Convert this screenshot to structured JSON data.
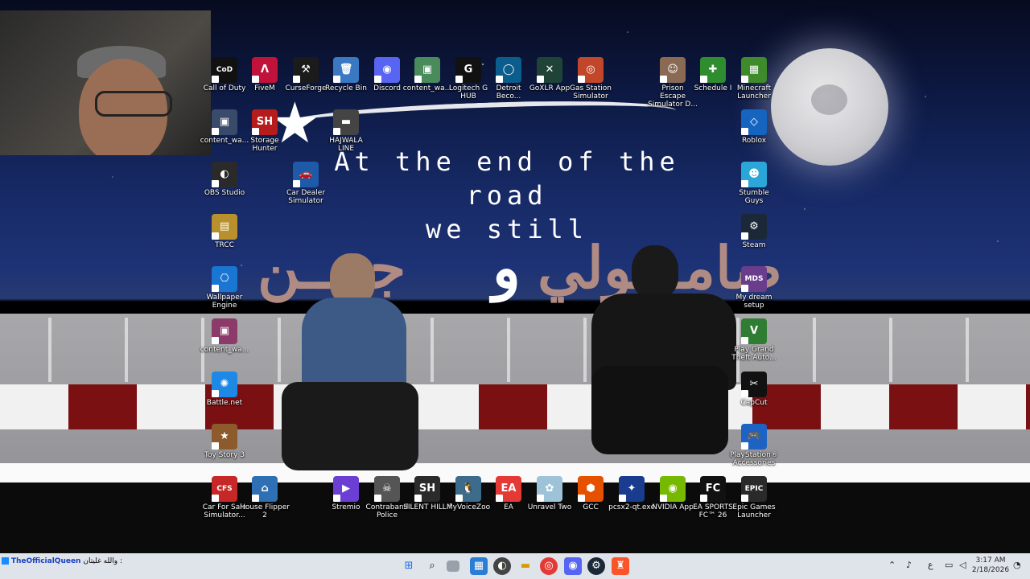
{
  "wallpaper": {
    "quote_line1": "At the end of the road",
    "quote_line2": "we still",
    "arabic_left": "جبـــن",
    "arabic_mid": "و",
    "arabic_right": "صامـــولي"
  },
  "desktop_icons": [
    {
      "label": "Call of Duty",
      "icon": "cod-icon",
      "color": "#111111",
      "glyph": "CoD"
    },
    {
      "label": "FiveM",
      "icon": "fivem-icon",
      "color": "#c0123a",
      "glyph": "Λ"
    },
    {
      "label": "CurseForge",
      "icon": "curseforge-icon",
      "color": "#1b1b1b",
      "glyph": "⚒"
    },
    {
      "label": "Recycle Bin",
      "icon": "recycle-bin-icon",
      "color": "#3a78c2",
      "glyph": "🗑"
    },
    {
      "label": "Discord",
      "icon": "discord-icon",
      "color": "#5865f2",
      "glyph": "◉"
    },
    {
      "label": "content_wa...",
      "icon": "image-file-icon",
      "color": "#4a8b5c",
      "glyph": "▣"
    },
    {
      "label": "Logitech G HUB",
      "icon": "logitech-icon",
      "color": "#111111",
      "glyph": "G"
    },
    {
      "label": "Detroit Beco...",
      "icon": "detroit-icon",
      "color": "#0a5d8c",
      "glyph": "◯"
    },
    {
      "label": "GoXLR App",
      "icon": "goxlr-icon",
      "color": "#1f4437",
      "glyph": "✕"
    },
    {
      "label": "Gas Station Simulator",
      "icon": "gas-station-icon",
      "color": "#c2462a",
      "glyph": "◎"
    },
    {
      "label": "Prison Escape Simulator D...",
      "icon": "prison-escape-icon",
      "color": "#8b6a55",
      "glyph": "☺"
    },
    {
      "label": "Schedule I",
      "icon": "schedule-i-icon",
      "color": "#2f8d2f",
      "glyph": "✚"
    },
    {
      "label": "Minecraft Launcher",
      "icon": "minecraft-icon",
      "color": "#3f8a2a",
      "glyph": "▦"
    },
    {
      "label": "content_wa...",
      "icon": "image-file-icon",
      "color": "#3a4a6a",
      "glyph": "▣"
    },
    {
      "label": "Storage Hunter",
      "icon": "storage-hunter-icon",
      "color": "#b71c1c",
      "glyph": "SH"
    },
    {
      "label": "HAJWALA LINE",
      "icon": "hajwala-icon",
      "color": "#444444",
      "glyph": "▬"
    },
    {
      "label": "Roblox",
      "icon": "roblox-icon",
      "color": "#1565c0",
      "glyph": "◇"
    },
    {
      "label": "OBS Studio",
      "icon": "obs-icon",
      "color": "#2a2a2a",
      "glyph": "◐"
    },
    {
      "label": "Car Dealer Simulator",
      "icon": "car-dealer-icon",
      "color": "#1e5aa8",
      "glyph": "🚗"
    },
    {
      "label": "Stumble Guys",
      "icon": "stumble-guys-icon",
      "color": "#2aa7d8",
      "glyph": "☻"
    },
    {
      "label": "TRCC",
      "icon": "trcc-icon",
      "color": "#b8902c",
      "glyph": "▤"
    },
    {
      "label": "Steam",
      "icon": "steam-icon",
      "color": "#1b2838",
      "glyph": "⚙"
    },
    {
      "label": "Wallpaper Engine",
      "icon": "wallpaper-engine-icon",
      "color": "#1976d2",
      "glyph": "⎔"
    },
    {
      "label": "My dream setup",
      "icon": "my-dream-setup-icon",
      "color": "#6a3c8c",
      "glyph": "MDS"
    },
    {
      "label": "content_wa...",
      "icon": "image-file-icon",
      "color": "#8c3a6a",
      "glyph": "▣"
    },
    {
      "label": "Play Grand Theft Auto...",
      "icon": "gta-icon",
      "color": "#2e7d32",
      "glyph": "V"
    },
    {
      "label": "Battle.net",
      "icon": "battlenet-icon",
      "color": "#1e88e5",
      "glyph": "✺"
    },
    {
      "label": "CapCut",
      "icon": "capcut-icon",
      "color": "#111111",
      "glyph": "✂"
    },
    {
      "label": "Toy Story 3",
      "icon": "toy-story-icon",
      "color": "#8d5a2b",
      "glyph": "★"
    },
    {
      "label": "PlayStation® Accessories",
      "icon": "playstation-accessories-icon",
      "color": "#1e63c4",
      "glyph": "🎮"
    },
    {
      "label": "Car For Sale Simulator...",
      "icon": "car-for-sale-icon",
      "color": "#c62828",
      "glyph": "CFS"
    },
    {
      "label": "House Flipper 2",
      "icon": "house-flipper-icon",
      "color": "#2f6fb3",
      "glyph": "⌂"
    },
    {
      "label": "Stremio",
      "icon": "stremio-icon",
      "color": "#6b3fd4",
      "glyph": "▶"
    },
    {
      "label": "Contraband Police",
      "icon": "contraband-police-icon",
      "color": "#555555",
      "glyph": "☠"
    },
    {
      "label": "SILENT HILL f",
      "icon": "silent-hill-icon",
      "color": "#2b2b2b",
      "glyph": "SH"
    },
    {
      "label": "MyVoiceZoo",
      "icon": "myvoicezoo-icon",
      "color": "#3d6b8c",
      "glyph": "🐧"
    },
    {
      "label": "EA",
      "icon": "ea-icon",
      "color": "#e53935",
      "glyph": "EA"
    },
    {
      "label": "Unravel Two",
      "icon": "unravel-two-icon",
      "color": "#9ec3d8",
      "glyph": "✿"
    },
    {
      "label": "GCC",
      "icon": "gcc-icon",
      "color": "#e65100",
      "glyph": "⬢"
    },
    {
      "label": "pcsx2-qt.exe",
      "icon": "pcsx2-icon",
      "color": "#1a3c8f",
      "glyph": "✦"
    },
    {
      "label": "NVIDIA App",
      "icon": "nvidia-icon",
      "color": "#76b900",
      "glyph": "◉"
    },
    {
      "label": "EA SPORTS FC™ 26",
      "icon": "ea-sports-fc-icon",
      "color": "#111111",
      "glyph": "FC"
    },
    {
      "label": "Epic Games Launcher",
      "icon": "epic-games-icon",
      "color": "#2a2a2a",
      "glyph": "EPIC"
    }
  ],
  "taskbar": {
    "notification_user": "TheOfficialQueen",
    "notification_text": "والله غليتان :",
    "search": "⌕",
    "tray_lang": "ع",
    "clock_time": "3:17 AM",
    "clock_date": "2/18/2026"
  }
}
